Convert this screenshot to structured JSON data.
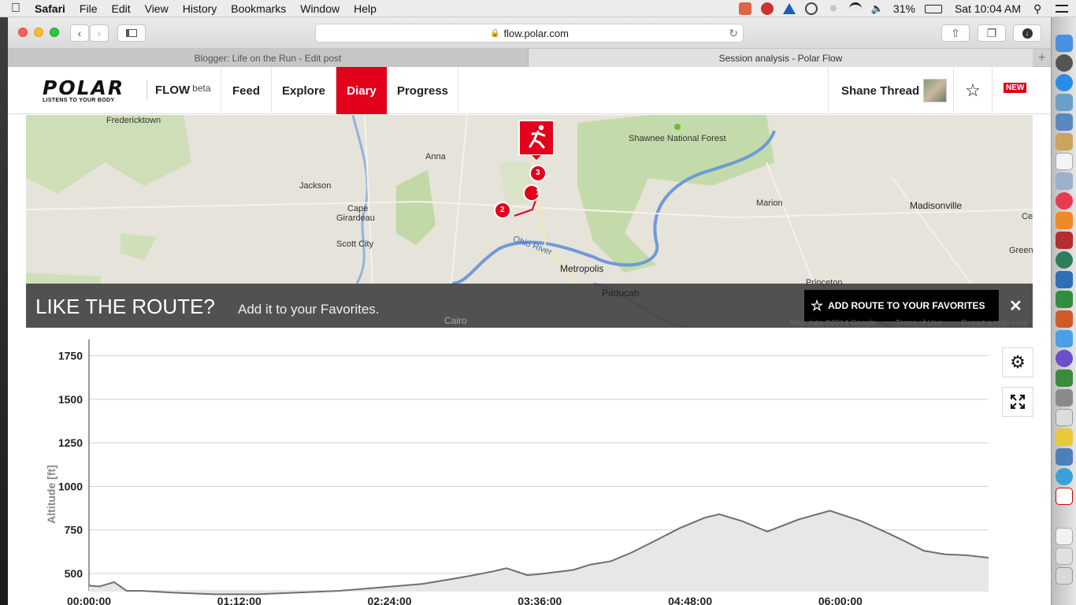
{
  "menubar": {
    "app": "Safari",
    "items": [
      "File",
      "Edit",
      "View",
      "History",
      "Bookmarks",
      "Window",
      "Help"
    ],
    "battery": "31%",
    "clock": "Sat 10:04 AM"
  },
  "browser": {
    "url": "flow.polar.com",
    "tabs": [
      "Blogger: Life on the Run - Edit post",
      "Session analysis - Polar Flow"
    ]
  },
  "polar": {
    "logo": "POLAR",
    "tagline": "LISTENS TO YOUR BODY",
    "flow": "FLOW",
    "beta": "beta",
    "nav": [
      "Feed",
      "Explore",
      "Diary",
      "Progress"
    ],
    "active_nav": "Diary",
    "user": "Shane Thread",
    "new_badge": "NEW"
  },
  "map": {
    "places": [
      "Fredericktown",
      "Anna",
      "Shawnee National Forest",
      "Jackson",
      "Cape",
      "Girardeau",
      "Scott City",
      "Marion",
      "Madisonville",
      "Ce",
      "Green",
      "Metropolis",
      "Paducah",
      "Princeton",
      "Cairo"
    ],
    "river_label": "Ohio River",
    "markers": [
      "1",
      "2",
      "3"
    ],
    "banner_title": "LIKE THE ROUTE?",
    "banner_subtitle": "Add it to your Favorites.",
    "add_button": "ADD ROUTE TO YOUR FAVORITES",
    "credits": [
      "Map data ©2014 Google",
      "Terms of Use",
      "Report a map error"
    ]
  },
  "chart_data": {
    "type": "area",
    "ylabel": "Altitude [ft]",
    "xlabel": "",
    "yticks": [
      "1750",
      "1500",
      "1250",
      "1000",
      "750",
      "500"
    ],
    "xticks": [
      "00:00:00",
      "01:12:00",
      "02:24:00",
      "03:36:00",
      "04:48:00",
      "06:00:00"
    ],
    "ylim": [
      400,
      1780
    ],
    "xlim_minutes": [
      0,
      431
    ],
    "x_minutes": [
      0,
      5,
      12,
      18,
      25,
      40,
      60,
      80,
      100,
      120,
      140,
      160,
      175,
      182,
      193,
      200,
      210,
      215,
      222,
      232,
      240,
      250,
      260,
      270,
      283,
      295,
      302,
      313,
      325,
      340,
      355,
      370,
      383,
      390,
      400,
      410,
      420,
      431
    ],
    "y_ft": [
      430,
      425,
      450,
      400,
      400,
      390,
      380,
      380,
      390,
      400,
      420,
      440,
      470,
      485,
      510,
      530,
      490,
      495,
      505,
      520,
      550,
      570,
      620,
      680,
      760,
      820,
      840,
      800,
      740,
      810,
      860,
      800,
      730,
      690,
      630,
      610,
      605,
      590
    ],
    "colors": {
      "area": "#e7e7e7",
      "line": "#6f6f6f"
    }
  }
}
